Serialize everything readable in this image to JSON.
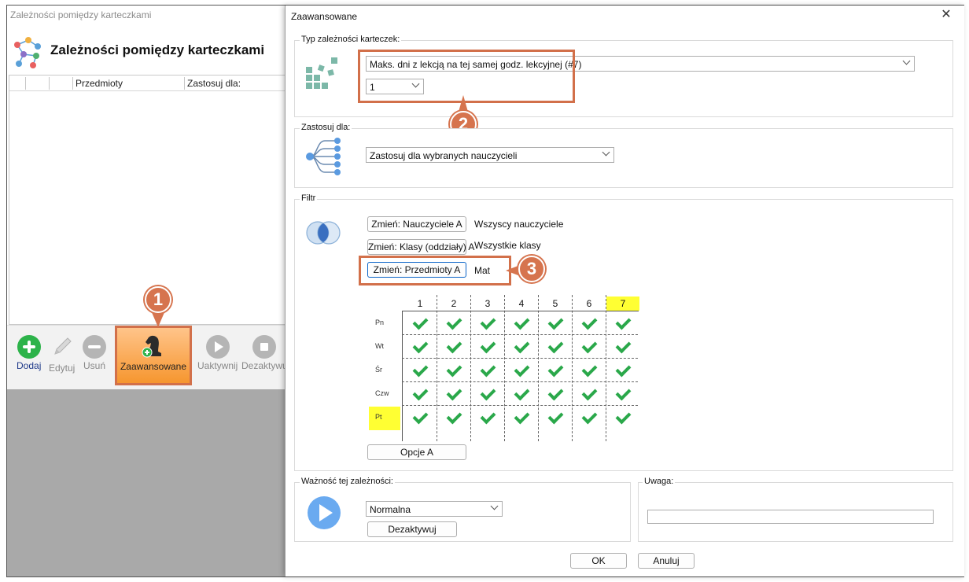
{
  "back_window": {
    "title": "Zależności pomiędzy karteczkami",
    "heading": "Zależności pomiędzy karteczkami",
    "columns": [
      "Przedmioty",
      "Zastosuj dla:"
    ],
    "toolbar": {
      "add": "Dodaj",
      "edit": "Edytuj",
      "remove": "Usuń",
      "advanced": "Zaawansowane",
      "activate": "Uaktywnij",
      "deactivate": "Dezaktywu"
    }
  },
  "badges": {
    "one": "1",
    "two": "2",
    "three": "3"
  },
  "dialog": {
    "title": "Zaawansowane",
    "close": "✕",
    "type_group": {
      "title": "Typ zależności karteczek:",
      "selected": "Maks. dni z lekcją na tej samej godz. lekcyjnej (#7)",
      "count_value": "1"
    },
    "apply_group": {
      "title": "Zastosuj dla:",
      "selected": "Zastosuj dla wybranych nauczycieli"
    },
    "filter_group": {
      "title": "Filtr",
      "teachers_button": "Zmień: Nauczyciele A",
      "teachers_value": "Wszyscy nauczyciele",
      "classes_button": "Zmień: Klasy (oddziały) A",
      "classes_value": "Wszystkie klasy",
      "subjects_button": "Zmień: Przedmioty A",
      "subjects_value": "Mat",
      "options_button": "Opcje A",
      "grid": {
        "columns": [
          "1",
          "2",
          "3",
          "4",
          "5",
          "6",
          "7"
        ],
        "highlighted_column": "7",
        "rows": [
          "Pn",
          "Wt",
          "Śr",
          "Czw",
          "Pt"
        ],
        "highlighted_row": "Pt",
        "all_checked": true
      }
    },
    "importance_group": {
      "title": "Ważność tej zależności:",
      "selected": "Normalna",
      "deactivate_button": "Dezaktywuj"
    },
    "note_group": {
      "title": "Uwaga:",
      "value": ""
    },
    "ok": "OK",
    "cancel": "Anuluj"
  },
  "colors": {
    "accent_orange": "#d2704a",
    "check_green": "#2aa84a",
    "highlight_yellow": "#ffff33",
    "add_green": "#2db34a"
  }
}
